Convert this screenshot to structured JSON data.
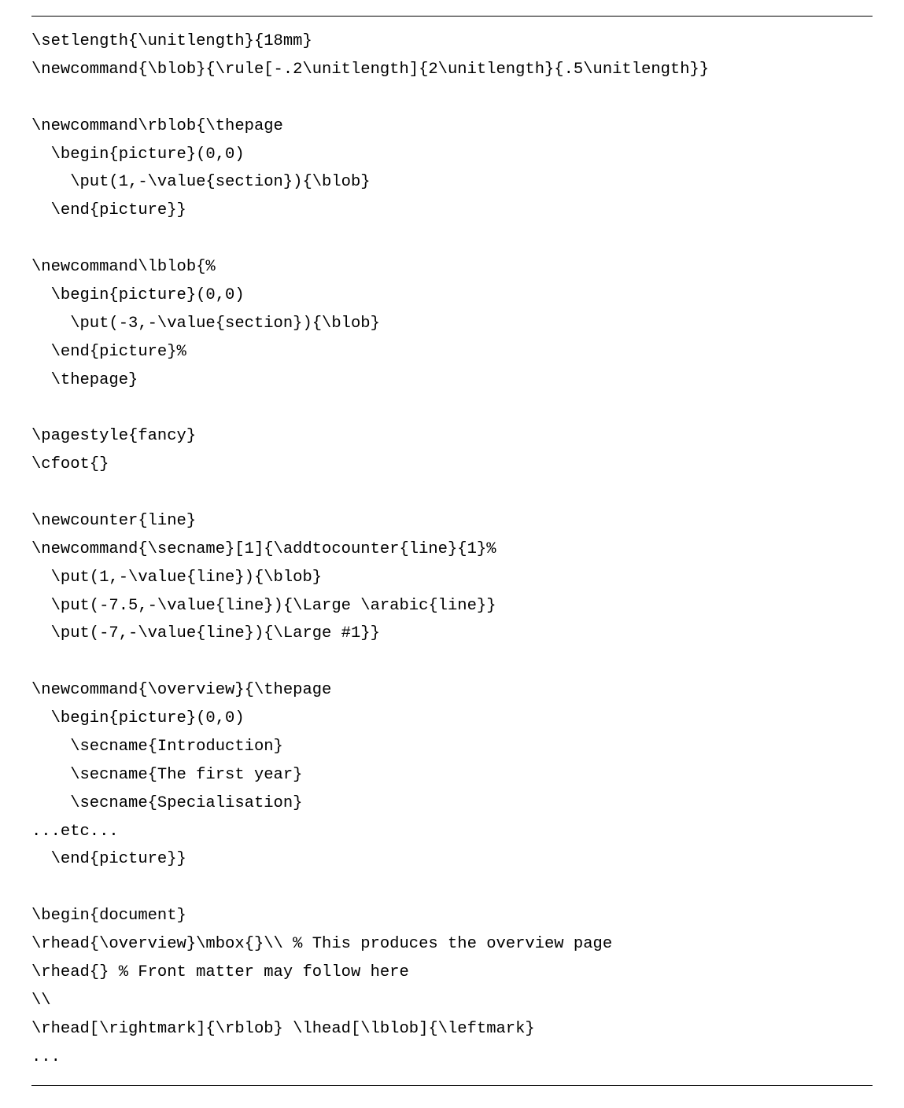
{
  "code": {
    "lines": [
      "\\setlength{\\unitlength}{18mm}",
      "\\newcommand{\\blob}{\\rule[-.2\\unitlength]{2\\unitlength}{.5\\unitlength}}",
      "",
      "\\newcommand\\rblob{\\thepage",
      "  \\begin{picture}(0,0)",
      "    \\put(1,-\\value{section}){\\blob}",
      "  \\end{picture}}",
      "",
      "\\newcommand\\lblob{%",
      "  \\begin{picture}(0,0)",
      "    \\put(-3,-\\value{section}){\\blob}",
      "  \\end{picture}%",
      "  \\thepage}",
      "",
      "\\pagestyle{fancy}",
      "\\cfoot{}",
      "",
      "\\newcounter{line}",
      "\\newcommand{\\secname}[1]{\\addtocounter{line}{1}%",
      "  \\put(1,-\\value{line}){\\blob}",
      "  \\put(-7.5,-\\value{line}){\\Large \\arabic{line}}",
      "  \\put(-7,-\\value{line}){\\Large #1}}",
      "",
      "\\newcommand{\\overview}{\\thepage",
      "  \\begin{picture}(0,0)",
      "    \\secname{Introduction}",
      "    \\secname{The first year}",
      "    \\secname{Specialisation}",
      "...etc...",
      "  \\end{picture}}",
      "",
      "\\begin{document}",
      "\\rhead{\\overview}\\mbox{}\\\\ % This produces the overview page",
      "\\rhead{} % Front matter may follow here",
      "\\\\",
      "\\rhead[\\rightmark]{\\rblob} \\lhead[\\lblob]{\\leftmark}",
      "..."
    ]
  }
}
